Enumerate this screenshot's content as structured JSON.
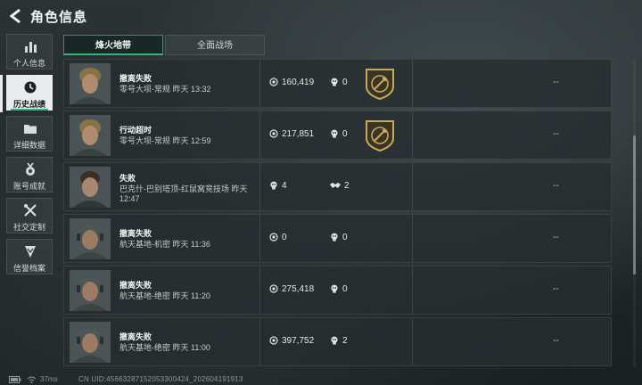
{
  "header": {
    "title": "角色信息"
  },
  "sidebar": {
    "items": [
      {
        "label": "个人信息",
        "icon": "bar-chart-icon",
        "active": false
      },
      {
        "label": "历史战绩",
        "icon": "clock-icon",
        "active": true
      },
      {
        "label": "详细数据",
        "icon": "folder-icon",
        "active": false
      },
      {
        "label": "账号成就",
        "icon": "medal-icon",
        "active": false
      },
      {
        "label": "社交定制",
        "icon": "tools-icon",
        "active": false
      },
      {
        "label": "信誉档案",
        "icon": "shield-icon",
        "active": false
      }
    ]
  },
  "tabs": [
    {
      "label": "烽火地带",
      "active": true
    },
    {
      "label": "全面战场",
      "active": false
    }
  ],
  "records": [
    {
      "result": "撤离失败",
      "map": "零号大坝-常规 昨天 13:32",
      "value": "160,419",
      "value_icon": "coin-icon",
      "kills": "0",
      "kills_icon": "skull-icon",
      "badge": true,
      "extra": "--"
    },
    {
      "result": "行动超时",
      "map": "零号大坝-常规 昨天 12:59",
      "value": "217,851",
      "value_icon": "coin-icon",
      "kills": "0",
      "kills_icon": "skull-icon",
      "badge": true,
      "extra": "--"
    },
    {
      "result": "失败",
      "map": "巴克什-巴别塔顶-红鼠窝竞技场 昨天 12:47",
      "value": "4",
      "value_icon": "skull-icon",
      "kills": "2",
      "kills_icon": "handshake-icon",
      "badge": false,
      "extra": "--"
    },
    {
      "result": "撤离失败",
      "map": "航天基地-机密 昨天 11:36",
      "value": "0",
      "value_icon": "coin-icon",
      "kills": "0",
      "kills_icon": "skull-icon",
      "badge": false,
      "extra": "--"
    },
    {
      "result": "撤离失败",
      "map": "航天基地-绝密 昨天 11:20",
      "value": "275,418",
      "value_icon": "coin-icon",
      "kills": "0",
      "kills_icon": "skull-icon",
      "badge": false,
      "extra": "--"
    },
    {
      "result": "撤离失败",
      "map": "航天基地-绝密 昨天 11:00",
      "value": "397,752",
      "value_icon": "coin-icon",
      "kills": "2",
      "kills_icon": "skull-icon",
      "badge": false,
      "extra": "--"
    }
  ],
  "footer": {
    "ping": "37ms",
    "uid": "CN UID:45663287152053300424_202604191913"
  },
  "colors": {
    "accent": "#2fb67a",
    "badge_gold": "#c8a95a"
  }
}
